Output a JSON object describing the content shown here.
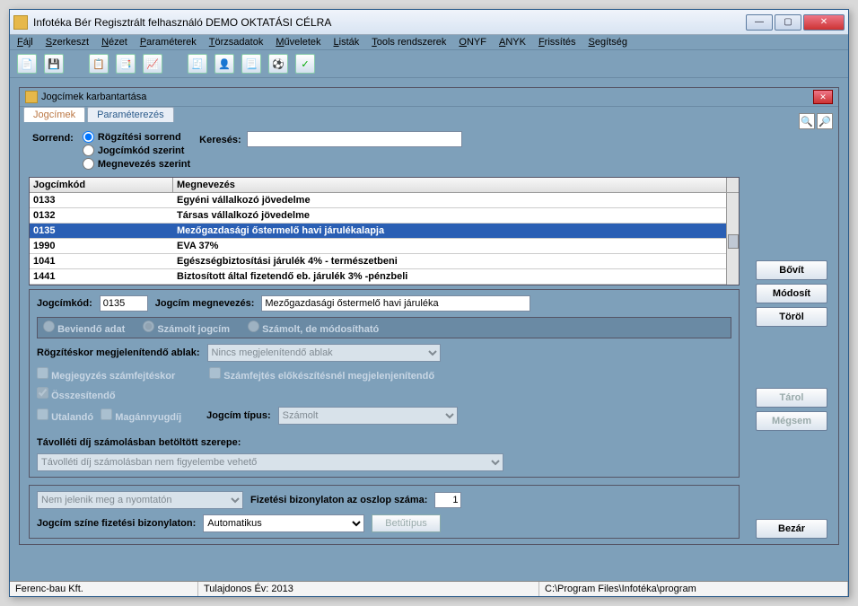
{
  "app": {
    "title": "Infotéka Bér Regisztrált felhasználó DEMO OKTATÁSI CÉLRA"
  },
  "menu": {
    "items": [
      "Fájl",
      "Szerkeszt",
      "Nézet",
      "Paraméterek",
      "Törzsadatok",
      "Műveletek",
      "Listák",
      "Tools rendszerek",
      "ONYF",
      "ANYK",
      "Frissítés",
      "Segítség"
    ]
  },
  "childWindow": {
    "title": "Jogcímek karbantartása"
  },
  "tabs": {
    "active": "Jogcímek",
    "other": "Paraméterezés"
  },
  "sort": {
    "label": "Sorrend:",
    "options": [
      "Rögzítési sorrend",
      "Jogcímkód szerint",
      "Megnevezés szerint"
    ],
    "selected": 0
  },
  "search": {
    "label": "Keresés:",
    "value": ""
  },
  "grid": {
    "headers": [
      "Jogcímkód",
      "Megnevezés"
    ],
    "rows": [
      {
        "code": "0133",
        "name": "Egyéni vállalkozó jövedelme",
        "sel": false
      },
      {
        "code": "0132",
        "name": "Társas vállalkozó jövedelme",
        "sel": false
      },
      {
        "code": "0135",
        "name": "Mezőgazdasági őstermelő havi járulékalapja",
        "sel": true
      },
      {
        "code": "1990",
        "name": "EVA  37%",
        "sel": false
      },
      {
        "code": "1041",
        "name": "Egészségbiztosítási járulék 4% - természetbeni",
        "sel": false
      },
      {
        "code": "1441",
        "name": "Biztosított által fizetendő eb. járulék 3% -pénzbeli",
        "sel": false
      }
    ]
  },
  "form": {
    "code_label": "Jogcímkód:",
    "code_value": "0135",
    "name_label": "Jogcím megnevezés:",
    "name_value": "Mezőgazdasági őstermelő havi járuléka",
    "radios": [
      "Beviendő adat",
      "Számolt jogcím",
      "Számolt, de módosítható"
    ],
    "window_label": "Rögzítéskor megjelenítendő ablak:",
    "window_value": "Nincs megjelenítendő ablak",
    "cb_note": "Megjegyzés számfejtéskor",
    "cb_prep": "Számfejtés előkészítésnél megjelenjenítendő",
    "cb_sum": "Összesítendő",
    "cb_trans": "Utalandó",
    "cb_priv": "Magánnyugdíj",
    "type_label": "Jogcím  típus:",
    "type_value": "Számolt",
    "away_label": "Távolléti díj számolásban betöltött szerepe:",
    "away_value": "Távolléti díj számolásban nem figyelembe vehető",
    "print_value": "Nem jelenik meg a nyomtatón",
    "col_label": "Fizetési bizonylaton az oszlop száma:",
    "col_value": "1",
    "color_label": "Jogcím színe fizetési bizonylaton:",
    "color_value": "Automatikus",
    "font_btn": "Betűtípus"
  },
  "buttons": {
    "bovit": "Bővít",
    "modosit": "Módosít",
    "torol": "Töröl",
    "tarol": "Tárol",
    "megsem": "Mégsem",
    "bezar": "Bezár"
  },
  "status": {
    "left": "Ferenc-bau Kft.",
    "mid": "Tulajdonos Év: 2013",
    "right": "C:\\Program Files\\Infotéka\\program"
  }
}
